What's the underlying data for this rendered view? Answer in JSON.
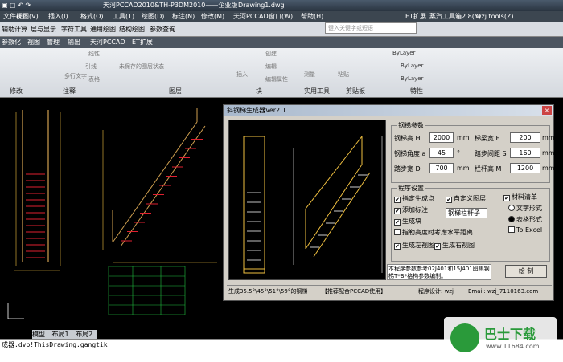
{
  "title": {
    "app": "天河PCCAD2010&TH-P3DM2010——企业版",
    "doc": "Drawing1.dwg",
    "search": "键入关键字或短语"
  },
  "menus": [
    "文件(F)",
    "视图(V)",
    "插入(I)",
    "格式(O)",
    "工具(T)",
    "绘图(D)",
    "标注(N)",
    "修改(M)",
    "天河PCCAD",
    "窗口(W)",
    "帮助(H)",
    "ET扩展",
    "蒸汽工具箱2.8(Y)",
    "wzj tools(Z)"
  ],
  "toolbar2": [
    "辅助计算",
    "层与显示",
    "字符工具",
    "通用绘图",
    "结构绘图",
    "参数查询"
  ],
  "tabs": [
    "参数化",
    "视图",
    "管理",
    "输出",
    "天河PCCAD",
    "ET扩展"
  ],
  "ribbon": {
    "groups": [
      "修改",
      "注释",
      "图层",
      "块",
      "实用工具",
      "剪贴板",
      "特性"
    ],
    "items": [
      "线性",
      "引线",
      "表格",
      "多行文字",
      "未保存的图层状态",
      "创建",
      "编辑",
      "编辑属性",
      "插入",
      "测量",
      "粘贴",
      "ByLayer",
      "ByLayer",
      "ByLayer"
    ]
  },
  "dialog": {
    "title": "斜钢梯生成器Ver2.1",
    "close": "×",
    "params_title": "钢梯参数",
    "labels": [
      "钢梯高 H",
      "梯梁宽 F",
      "钢梯角度 a",
      "踏步间距 S",
      "踏步宽 D",
      "栏杆高 M"
    ],
    "values": [
      "2000",
      "200",
      "45",
      "160",
      "700",
      "1200"
    ],
    "units": [
      "mm",
      "mm",
      "°",
      "mm",
      "mm",
      "mm"
    ],
    "settings_title": "程序设置",
    "checks": [
      {
        "label": "指定生成点",
        "checked": true
      },
      {
        "label": "添加标注",
        "checked": true
      },
      {
        "label": "生成块",
        "checked": true
      },
      {
        "label": "指勒高度时考虑水平距离",
        "checked": false
      },
      {
        "label": "生成左视图",
        "checked": true
      },
      {
        "label": "生成右视图",
        "checked": true
      }
    ],
    "custom_layer": "自定义图层",
    "custom_layer_checked": true,
    "layer_select": "钢梯栏杆子",
    "material": "材料清单",
    "material_checked": true,
    "radios": [
      {
        "label": "文字形式",
        "checked": false
      },
      {
        "label": "表格形式",
        "checked": true
      }
    ],
    "excel": "To Excel",
    "note": "本程序参数参考02J401和15J401图集钢梯T*B*格构参数编制。",
    "draw": "绘 制",
    "status": [
      "生成35.5°\\45°\\51°\\59°的钢梯",
      "【推荐配合PCCAD使用】",
      "程序设计: wzj",
      "Email: wzj_7110163.com"
    ]
  },
  "layout_tabs": [
    "模型",
    "布局1",
    "布局2"
  ],
  "cmd": "成器.dvb!ThisDrawing.gangtik",
  "watermark": {
    "name": "巴士下载",
    "url": "www.11684.com"
  },
  "colors": {
    "dim": "#f0c040",
    "stair": "#e02030",
    "rail": "#d0a050",
    "preview": "#ffffff"
  }
}
